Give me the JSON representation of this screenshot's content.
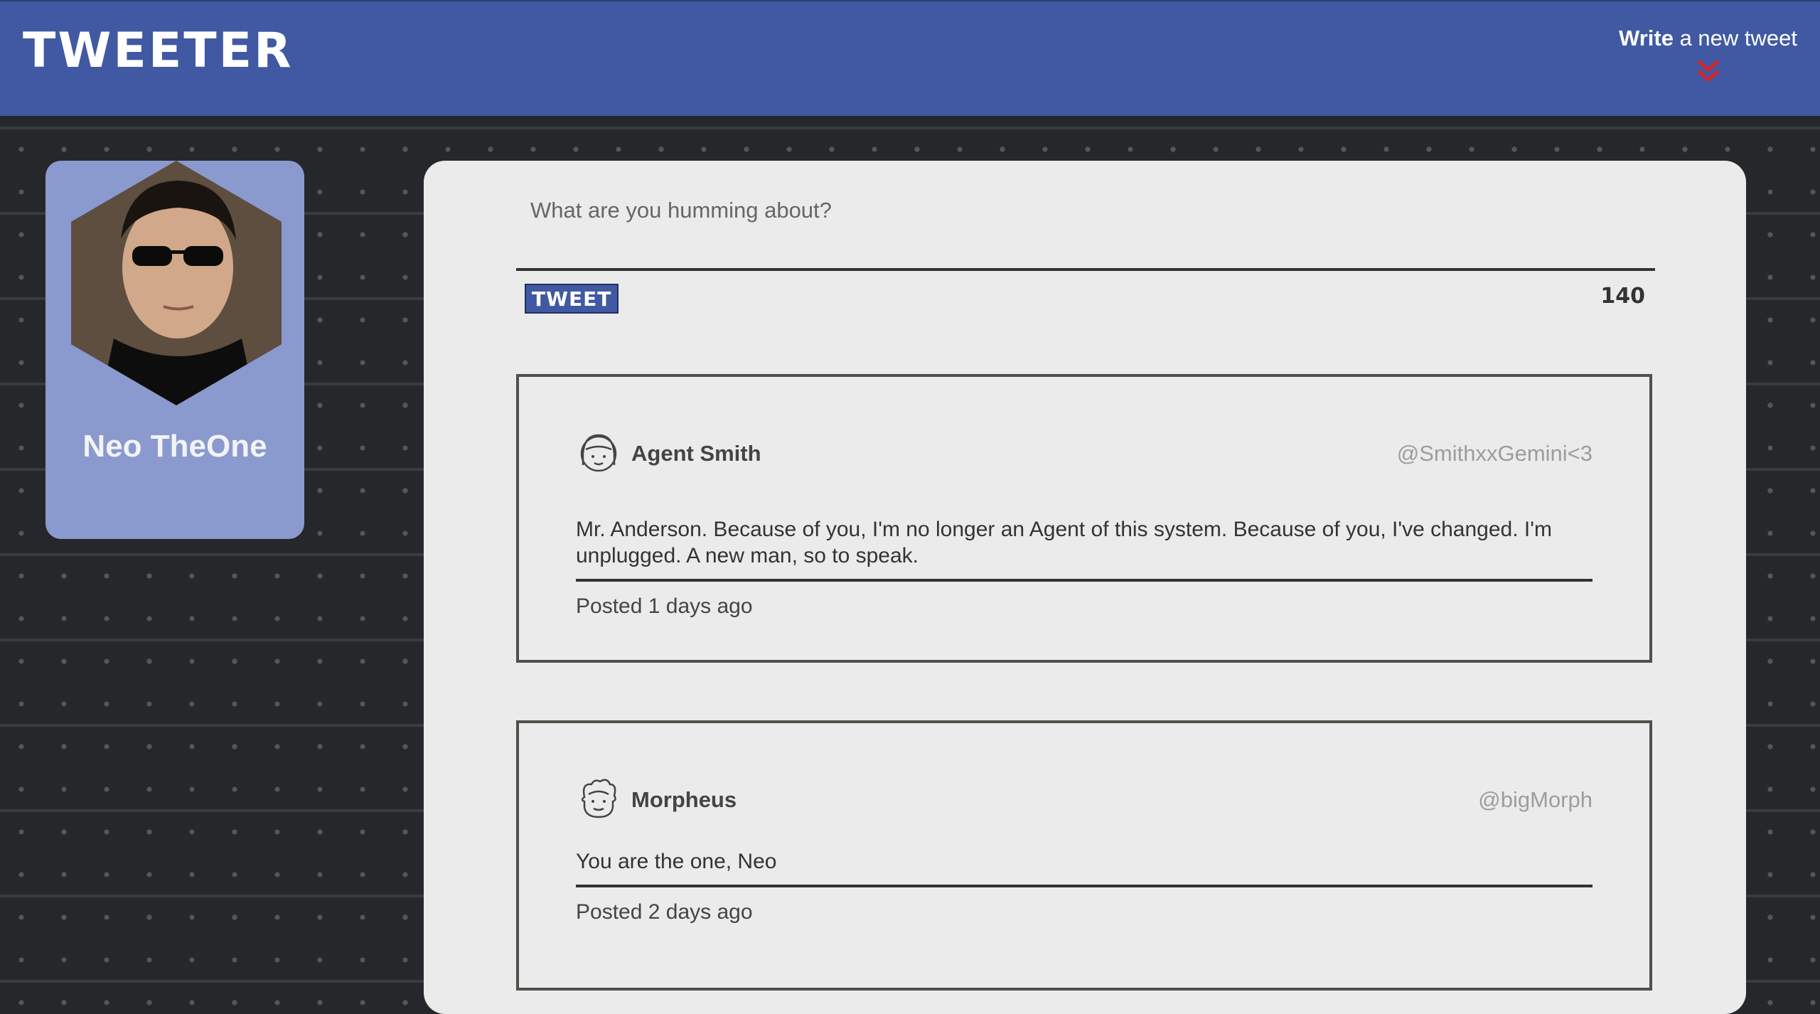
{
  "nav": {
    "brand": "TWEETER",
    "compose_bold": "Write",
    "compose_rest": " a new tweet",
    "chevron_icon": "double-chevron-down-icon",
    "chevron_color": "#d0252a"
  },
  "profile": {
    "name": "Neo TheOne"
  },
  "composer": {
    "placeholder": "What are you humming about?",
    "button_label": "TWEET",
    "counter": "140"
  },
  "tweets": [
    {
      "name": "Agent Smith",
      "handle": "@SmithxxGemini<3",
      "text": "Mr. Anderson. Because of you, I'm no longer an Agent of this system. Because of you, I've changed. I'm unplugged. A new man, so to speak.",
      "posted": "Posted 1 days ago",
      "avatar_icon": "girl-face-icon"
    },
    {
      "name": "Morpheus",
      "handle": "@bigMorph",
      "text": "You are the one, Neo",
      "posted": "Posted 2 days ago",
      "avatar_icon": "curly-hair-face-icon"
    }
  ],
  "colors": {
    "nav_bg": "#4059a2",
    "profile_bg": "#8a9ace",
    "panel_bg": "#ebebeb",
    "accent_red": "#d0252a"
  }
}
